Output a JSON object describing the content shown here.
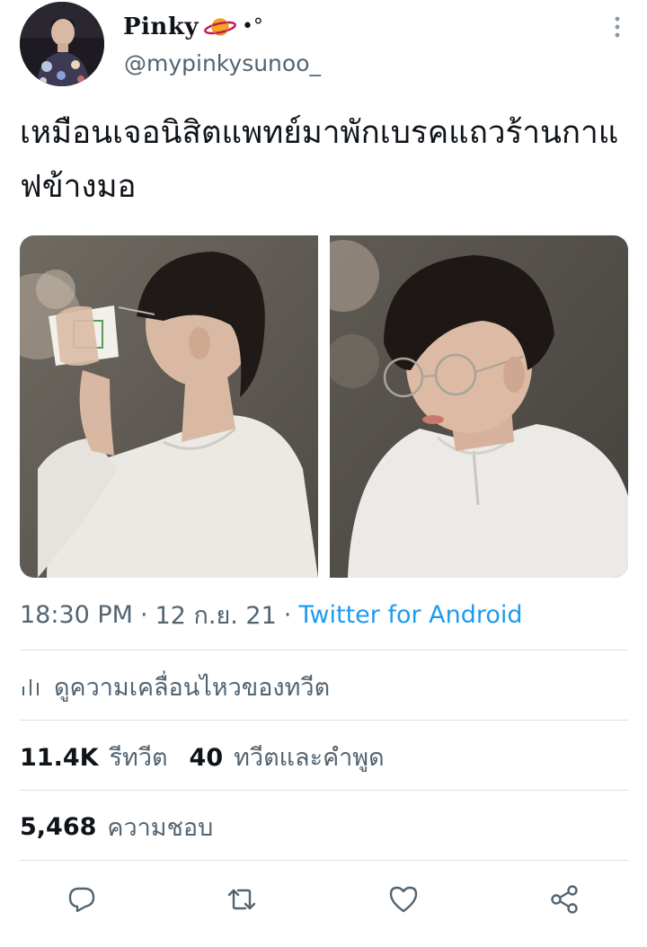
{
  "author": {
    "display_name": "Pinky",
    "decoration": "•°",
    "handle": "@mypinkysunoo_",
    "avatar_icon": "profile-photo"
  },
  "tweet": {
    "text": "เหมือนเจอนิสิตแพทย์มาพักเบรคแถวร้านกาแฟข้างมอ"
  },
  "media": [
    {
      "alt": "photo-drinking-from-cup"
    },
    {
      "alt": "photo-looking-down-with-glasses"
    }
  ],
  "meta": {
    "time": "18:30 PM",
    "separator": "·",
    "date": "12 ก.ย. 21",
    "source": "Twitter for Android"
  },
  "activity": {
    "label": "ดูความเคลื่อนไหวของทวีต",
    "icon": "analytics-icon"
  },
  "stats": {
    "retweets_count": "11.4K",
    "retweets_label": "รีทวีต",
    "quotes_count": "40",
    "quotes_label": "ทวีตและคำพูด",
    "likes_count": "5,468",
    "likes_label": "ความชอบ"
  },
  "actions": [
    {
      "name": "reply-icon"
    },
    {
      "name": "retweet-icon"
    },
    {
      "name": "like-icon"
    },
    {
      "name": "share-icon"
    }
  ],
  "colors": {
    "text_primary": "#0f1419",
    "text_secondary": "#536471",
    "link": "#1d9bf0",
    "divider": "#dadfe3"
  }
}
